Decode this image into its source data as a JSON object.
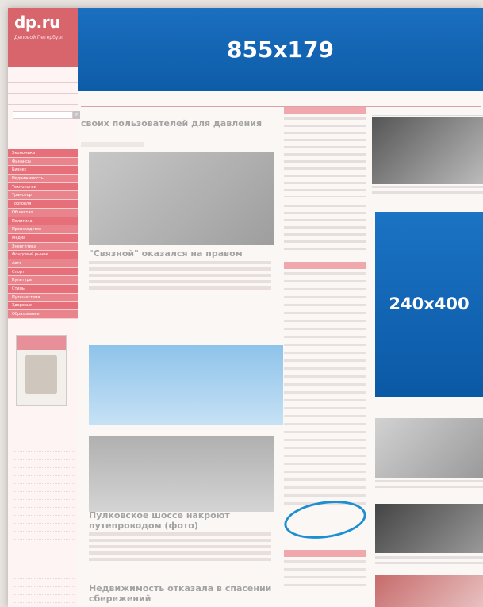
{
  "site": {
    "logo": "dp.ru",
    "tagline": "Деловой Петербург"
  },
  "banners": {
    "top": "855x179",
    "side": "240x400"
  },
  "headlines": {
    "h1": "своих пользователей для давления",
    "h2": "\"Связной\" оказался на правом",
    "h3": "Пулковское шоссе накроют путепроводом (фото)",
    "h4": "Недвижимость отказала в спасении сбережений"
  },
  "menu_items": [
    "Экономика",
    "Финансы",
    "Бизнес",
    "Недвижимость",
    "Технологии",
    "Транспорт",
    "Торговля",
    "Общество",
    "Политика",
    "Производство",
    "Медиа",
    "Энергетика",
    "Фондовый рынок",
    "Авто",
    "Спорт",
    "Культура",
    "Стиль",
    "Путешествия",
    "Здоровье",
    "Образование"
  ],
  "icons": {
    "search": "search-icon"
  }
}
